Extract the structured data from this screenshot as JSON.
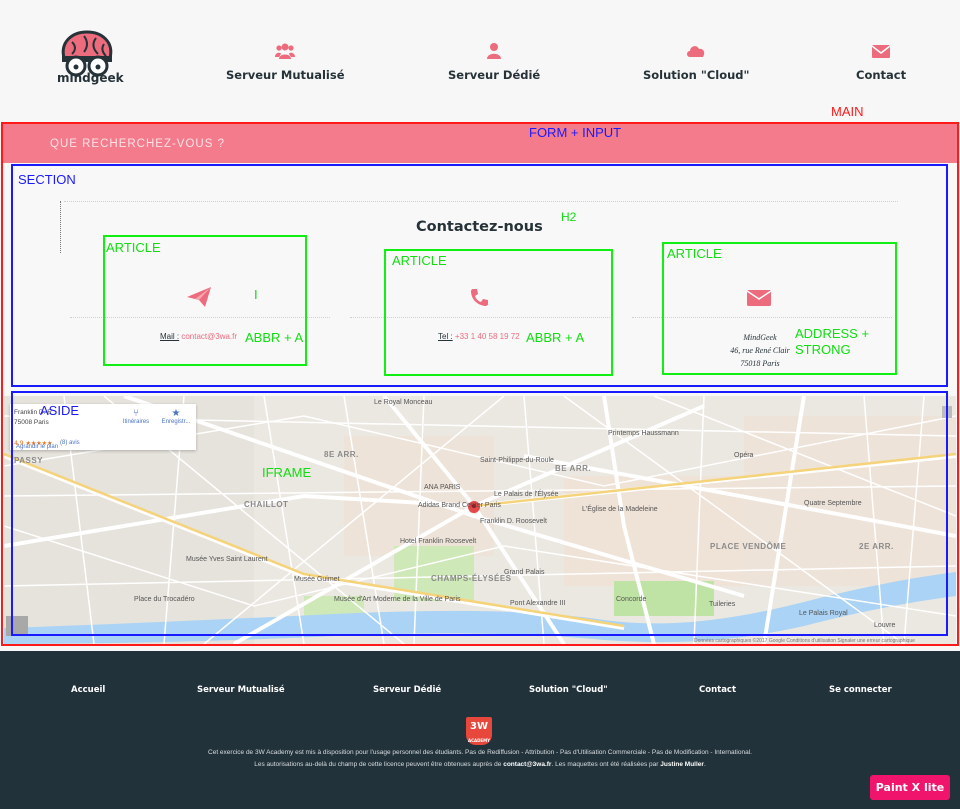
{
  "header": {
    "logo_text": "mindgeek",
    "nav": [
      {
        "label": "Serveur Mutualisé",
        "icon": "users-icon"
      },
      {
        "label": "Serveur Dédié",
        "icon": "user-icon"
      },
      {
        "label": "Solution \"Cloud\"",
        "icon": "cloud-icon"
      },
      {
        "label": "Contact",
        "icon": "envelope-icon"
      }
    ]
  },
  "search": {
    "placeholder": "QUE RECHERCHEZ-VOUS ?"
  },
  "section": {
    "title": "Contactez-nous",
    "cards": [
      {
        "icon": "paper-plane-icon",
        "label": "Mail :",
        "value": "contact@3wa.fr"
      },
      {
        "icon": "phone-icon",
        "label": "Tel :",
        "value": "+33 1 40 58 19 72"
      },
      {
        "icon": "envelope-icon",
        "address": [
          "MindGeek",
          "46, rue René Clair",
          "75018 Paris"
        ]
      }
    ]
  },
  "annotations": {
    "main": "MAIN",
    "form": "FORM + INPUT",
    "section": "SECTION",
    "h2": "H2",
    "article1": "ARTICLE",
    "article2": "ARTICLE",
    "article3": "ARTICLE",
    "i": "I",
    "abbr1": "ABBR + A",
    "abbr2": "ABBR + A",
    "address1": "ADDRESS +",
    "address2": "STRONG",
    "aside": "ASIDE",
    "iframe": "IFRAME"
  },
  "map": {
    "card_lines": [
      "Franklin D. R",
      "75008 Paris"
    ],
    "rating": "4,9 ★★★★★",
    "reviews": "(8) avis",
    "itineraire": "Itinéraires",
    "enregistrer": "Enregistr...",
    "agrandir": "Agrandir le plan",
    "labels": [
      "CHAILLOT",
      "PASSY",
      "CHAMPS-ÉLYSÉES",
      "PLACE VENDÔME",
      "8E ARR.",
      "2E ARR.",
      "BE ARR.",
      "Franklin D. Roosevelt",
      "Le Palais de l'Élysée",
      "Hotel Franklin Roosevelt",
      "Tuileries",
      "Le Palais Royal",
      "Louvre",
      "Musée Guimet",
      "Saint-Philippe-du-Roule",
      "Adidas Brand Center Paris",
      "Grand Palais",
      "Pont Alexandre III",
      "ANA PARIS",
      "Le Royal Monceau",
      "Printemps Haussmann",
      "Opéra",
      "Quatre Septembre",
      "L'Église de la Madeleine",
      "Concorde",
      "Musée Yves Saint Laurent",
      "Place du Trocadéro",
      "Musée d'Art Moderne de la Ville de Paris"
    ],
    "footer": "Données cartographiques ©2017 Google  Conditions d'utilisation  Signaler une erreur cartographique"
  },
  "footer": {
    "links": [
      "Accueil",
      "Serveur Mutualisé",
      "Serveur Dédié",
      "Solution \"Cloud\"",
      "Contact",
      "Se connecter"
    ],
    "badge": "3W",
    "badge_sub": "ACADEMY",
    "legal_line1": "Cet exercice de 3W Academy est mis à disposition pour l'usage personnel des étudiants. Pas de Rediffusion - Attribution - Pas d'Utilisation Commerciale - Pas de Modification - International.",
    "legal_line2_a": "Les autorisations au-delà du champ de cette licence peuvent être obtenues auprès de ",
    "legal_email": "contact@3wa.fr",
    "legal_line2_b": ". Les maquettes ont été réalisées par ",
    "legal_author": "Justine Muller",
    "legal_end": "."
  },
  "watermark": "Paint X lite",
  "colors": {
    "brand_pink": "#f37b8c",
    "dark": "#22323a",
    "text": "#253238"
  }
}
